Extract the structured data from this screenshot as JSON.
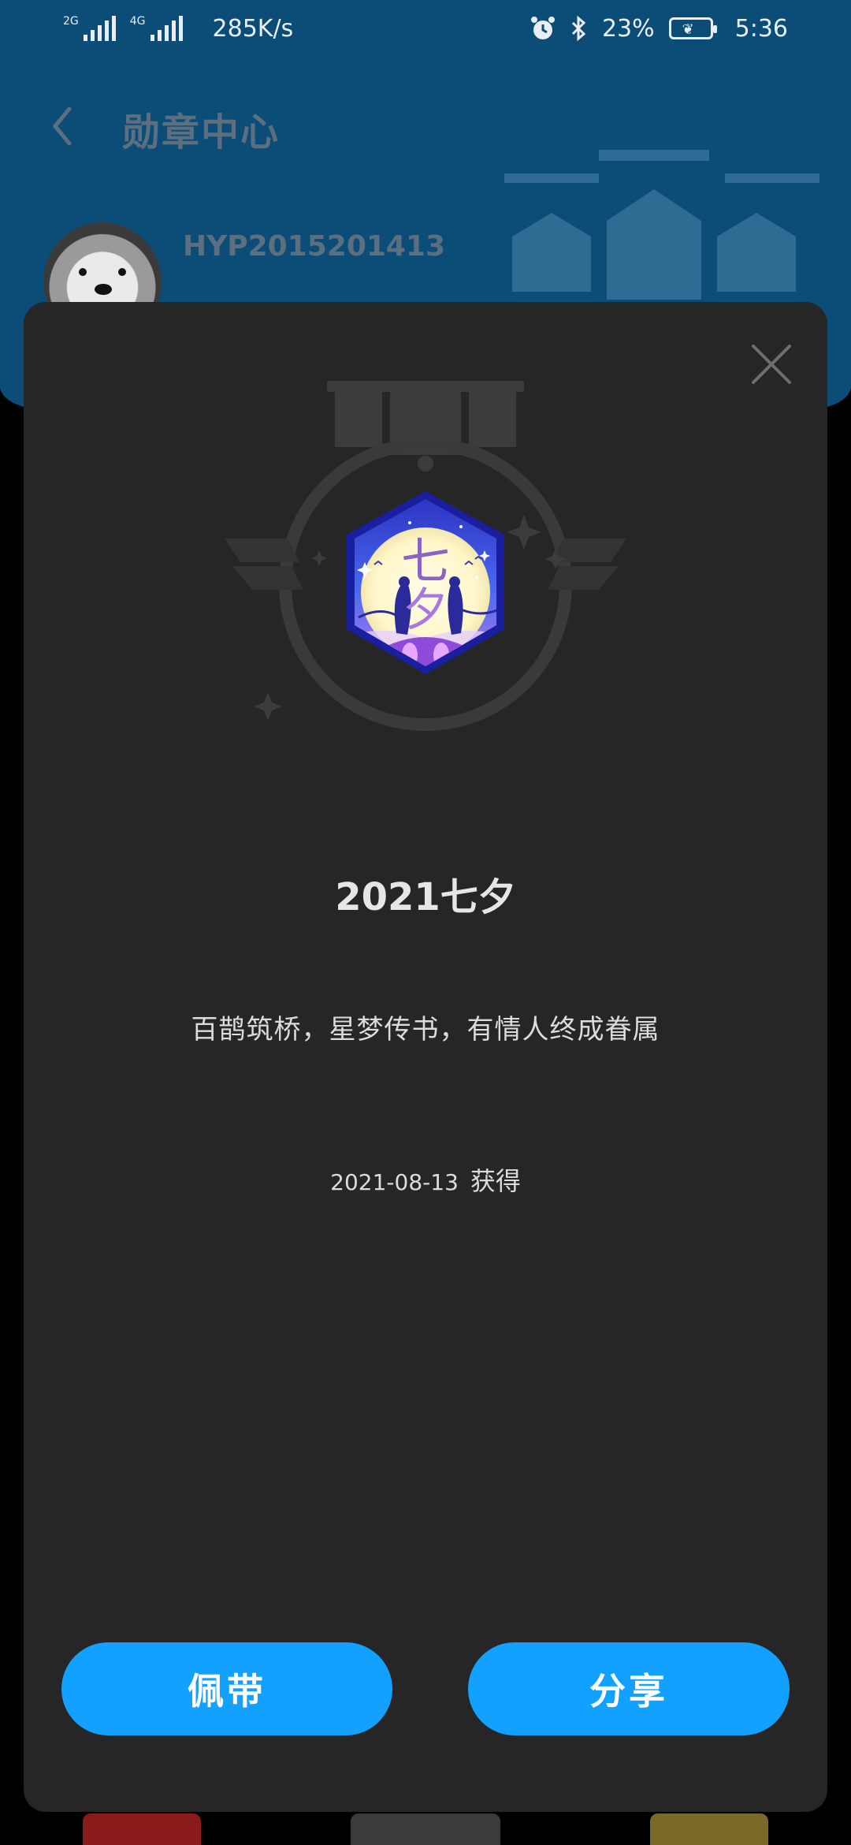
{
  "status_bar": {
    "signal1_label": "2G",
    "signal2_label": "4G",
    "speed": "285K/s",
    "battery": "23%",
    "time": "5:36"
  },
  "header": {
    "title": "勋章中心",
    "username": "HYP2015201413"
  },
  "dialog": {
    "medal_title": "2021七夕",
    "medal_badge_text_top": "七",
    "medal_badge_text_bottom": "夕",
    "medal_description": "百鹊筑桥，星梦传书，有情人终成眷属",
    "obtained_date": "2021-08-13",
    "obtained_suffix": "获得",
    "wear_button": "佩带",
    "share_button": "分享"
  },
  "colors": {
    "accent": "#12a1ff",
    "dialog_bg": "#262626",
    "header_bg": "#0b4d77"
  }
}
